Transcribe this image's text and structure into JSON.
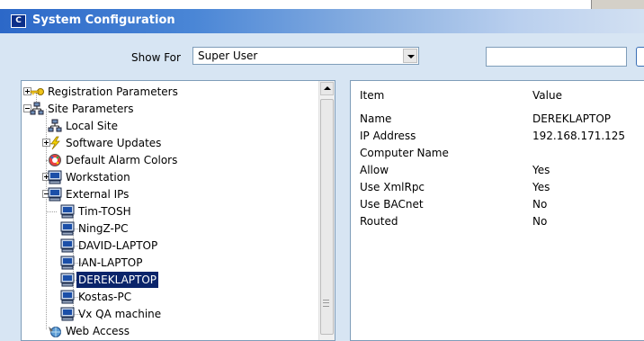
{
  "window": {
    "title": "System Configuration",
    "app_icon": "app-icon"
  },
  "toolbar": {
    "show_for_label": "Show For",
    "show_for_value": "Super User",
    "search_value": ""
  },
  "tree": {
    "selected": "DEREKLAPTOP",
    "nodes": [
      {
        "label": "Registration Parameters",
        "icon": "key-icon",
        "expander": "plus"
      },
      {
        "label": "Site Parameters",
        "icon": "network-icon",
        "expander": "minus"
      },
      {
        "label": "Local Site",
        "icon": "network-icon",
        "expander": ""
      },
      {
        "label": "Software Updates",
        "icon": "lightning-icon",
        "expander": "plus"
      },
      {
        "label": "Default Alarm Colors",
        "icon": "palette-icon",
        "expander": ""
      },
      {
        "label": "Workstation",
        "icon": "computer-icon",
        "expander": "plus"
      },
      {
        "label": "External IPs",
        "icon": "computer-icon",
        "expander": "minus"
      },
      {
        "label": "Tim-TOSH",
        "icon": "computer-icon",
        "expander": ""
      },
      {
        "label": "NingZ-PC",
        "icon": "computer-icon",
        "expander": ""
      },
      {
        "label": "DAVID-LAPTOP",
        "icon": "computer-icon",
        "expander": ""
      },
      {
        "label": "IAN-LAPTOP",
        "icon": "computer-icon",
        "expander": ""
      },
      {
        "label": "DEREKLAPTOP",
        "icon": "computer-icon",
        "expander": ""
      },
      {
        "label": "Kostas-PC",
        "icon": "computer-icon",
        "expander": ""
      },
      {
        "label": "Vx QA machine",
        "icon": "computer-icon",
        "expander": ""
      },
      {
        "label": "Web Access",
        "icon": "globe-icon",
        "expander": ""
      }
    ]
  },
  "properties": {
    "headers": {
      "item": "Item",
      "value": "Value"
    },
    "rows": [
      {
        "item": "Name",
        "value": "DEREKLAPTOP"
      },
      {
        "item": "IP Address",
        "value": "192.168.171.125"
      },
      {
        "item": "Computer Name",
        "value": ""
      },
      {
        "item": "Allow",
        "value": "Yes"
      },
      {
        "item": "Use XmlRpc",
        "value": "Yes"
      },
      {
        "item": "Use BACnet",
        "value": "No"
      },
      {
        "item": "Routed",
        "value": "No"
      }
    ]
  },
  "colors": {
    "title_start": "#2c68c8",
    "panel": "#d7e5f3",
    "selection": "#0a246a"
  }
}
